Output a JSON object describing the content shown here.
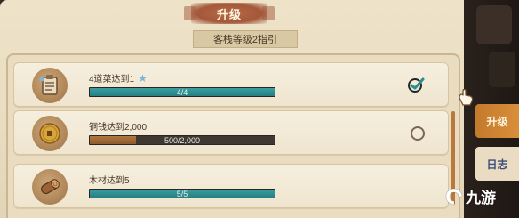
{
  "header": {
    "banner_title": "升级",
    "subtitle": "客栈等级2指引"
  },
  "tasks": [
    {
      "label": "4道菜达到1",
      "icon": "recipe-board-icon",
      "has_star": true,
      "progress_text": "4/4",
      "progress": 1.0,
      "bar_color": "#2d8c8f",
      "status": "completed"
    },
    {
      "label": "铜钱达到2,000",
      "icon": "copper-coin-icon",
      "has_star": false,
      "progress_text": "500/2,000",
      "progress": 0.25,
      "bar_color": "#a06a36",
      "status": "incomplete"
    },
    {
      "label": "木材达到5",
      "icon": "wood-log-icon",
      "has_star": false,
      "progress_text": "5/5",
      "progress": 1.0,
      "bar_color": "#2d8c8f",
      "status": "completed"
    }
  ],
  "side_tabs": [
    {
      "label": "升级",
      "active": true
    },
    {
      "label": "日志",
      "active": false
    }
  ],
  "watermark": {
    "logo_text": "九游"
  },
  "colors": {
    "accent_orange": "#c47a2c",
    "teal_fill": "#2d8c8f",
    "brown_fill": "#a06a36",
    "parchment": "#eee2c8"
  }
}
